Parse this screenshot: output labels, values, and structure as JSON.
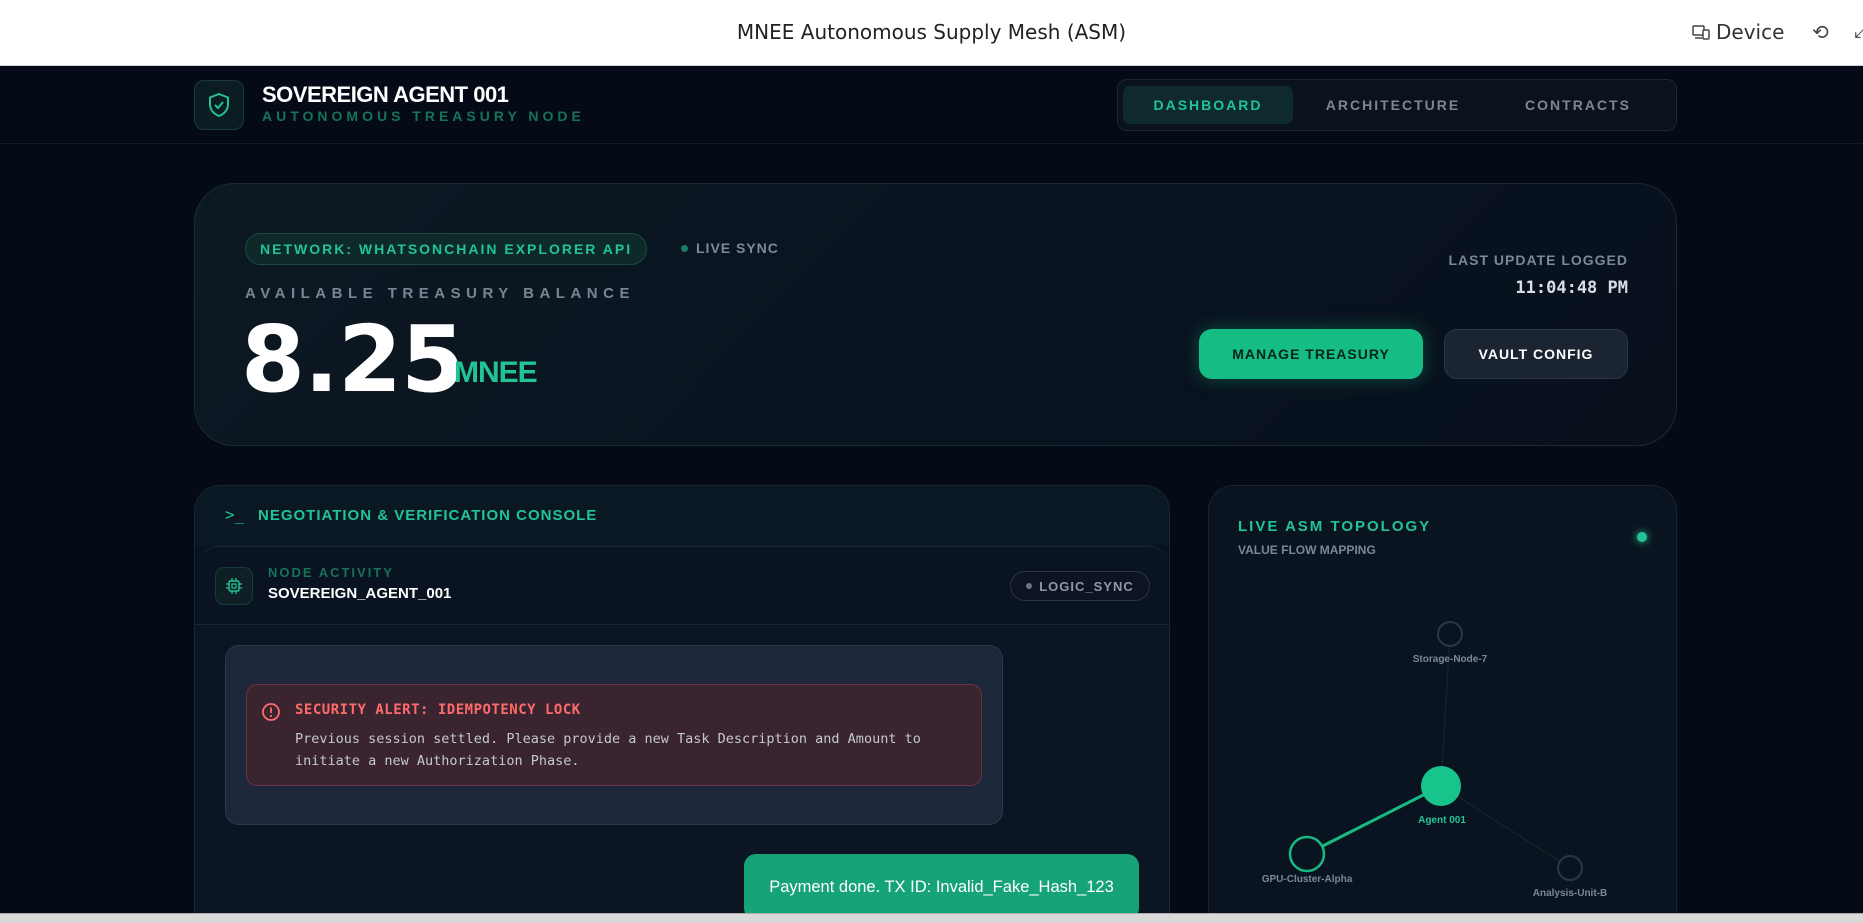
{
  "browser": {
    "title": "MNEE Autonomous Supply Mesh (ASM)",
    "device_label": "Device"
  },
  "header": {
    "brand_name": "SOVEREIGN AGENT 001",
    "brand_sub": "AUTONOMOUS TREASURY NODE",
    "tabs": [
      {
        "label": "DASHBOARD",
        "active": true
      },
      {
        "label": "ARCHITECTURE",
        "active": false
      },
      {
        "label": "CONTRACTS",
        "active": false
      }
    ]
  },
  "treasury": {
    "network_badge": "NETWORK: WHATSONCHAIN EXPLORER API",
    "sync_label": "LIVE SYNC",
    "balance_label": "AVAILABLE TREASURY BALANCE",
    "balance_value": "8.25",
    "balance_unit": "MNEE",
    "last_update_label": "LAST UPDATE LOGGED",
    "last_update_value": "11:04:48 PM",
    "manage_button": "MANAGE TREASURY",
    "vault_button": "VAULT CONFIG"
  },
  "console": {
    "title": "NEGOTIATION & VERIFICATION CONSOLE",
    "node_label": "NODE ACTIVITY",
    "node_name": "SOVEREIGN_AGENT_001",
    "status_badge": "LOGIC_SYNC",
    "alert_title": "SECURITY ALERT: IDEMPOTENCY LOCK",
    "alert_text": "Previous session settled. Please provide a new Task Description and Amount to initiate a new Authorization Phase.",
    "payment_message": "Payment done. TX ID: Invalid_Fake_Hash_123"
  },
  "topology": {
    "title": "LIVE ASM TOPOLOGY",
    "subtitle": "VALUE FLOW MAPPING",
    "nodes": [
      {
        "label": "Storage-Node-7",
        "active": false
      },
      {
        "label": "Agent 001",
        "active": true
      },
      {
        "label": "GPU-Cluster-Alpha",
        "active": false
      },
      {
        "label": "Analysis-Unit-B",
        "active": false
      }
    ]
  },
  "colors": {
    "accent": "#22c493",
    "background": "#050b16",
    "alert": "#ff6b6b"
  }
}
